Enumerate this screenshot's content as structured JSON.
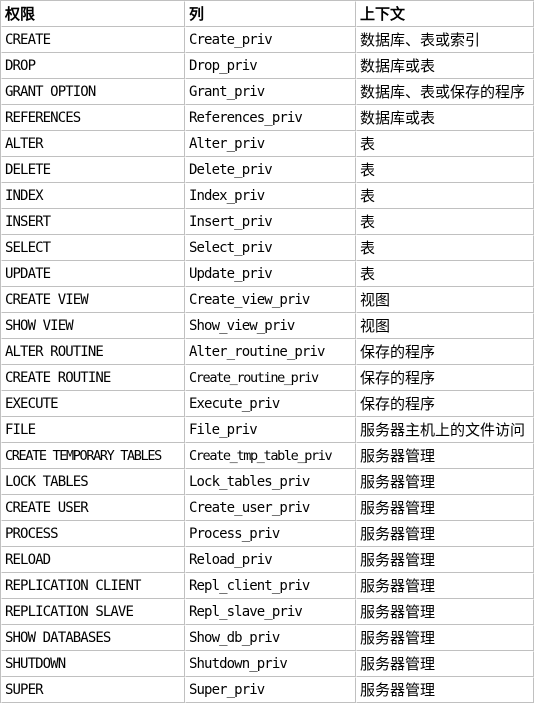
{
  "table": {
    "name": "mysql-privileges-reference-table",
    "columns": [
      {
        "key": "privilege",
        "label": "权限"
      },
      {
        "key": "column",
        "label": "列"
      },
      {
        "key": "context",
        "label": "上下文"
      }
    ],
    "rows": [
      {
        "privilege": "CREATE",
        "column": "Create_priv",
        "context": "数据库、表或索引"
      },
      {
        "privilege": "DROP",
        "column": "Drop_priv",
        "context": "数据库或表"
      },
      {
        "privilege": "GRANT OPTION",
        "column": "Grant_priv",
        "context": "数据库、表或保存的程序"
      },
      {
        "privilege": "REFERENCES",
        "column": "References_priv",
        "context": "数据库或表"
      },
      {
        "privilege": "ALTER",
        "column": "Alter_priv",
        "context": "表"
      },
      {
        "privilege": "DELETE",
        "column": "Delete_priv",
        "context": "表"
      },
      {
        "privilege": "INDEX",
        "column": "Index_priv",
        "context": "表"
      },
      {
        "privilege": "INSERT",
        "column": "Insert_priv",
        "context": "表"
      },
      {
        "privilege": "SELECT",
        "column": "Select_priv",
        "context": "表"
      },
      {
        "privilege": "UPDATE",
        "column": "Update_priv",
        "context": "表"
      },
      {
        "privilege": "CREATE VIEW",
        "column": "Create_view_priv",
        "context": "视图"
      },
      {
        "privilege": "SHOW VIEW",
        "column": "Show_view_priv",
        "context": "视图"
      },
      {
        "privilege": "ALTER ROUTINE",
        "column": "Alter_routine_priv",
        "context": "保存的程序"
      },
      {
        "privilege": "CREATE ROUTINE",
        "column": "Create_routine_priv",
        "context": "保存的程序"
      },
      {
        "privilege": "EXECUTE",
        "column": "Execute_priv",
        "context": "保存的程序"
      },
      {
        "privilege": "FILE",
        "column": "File_priv",
        "context": "服务器主机上的文件访问"
      },
      {
        "privilege": "CREATE TEMPORARY TABLES",
        "column": "Create_tmp_table_priv",
        "context": "服务器管理"
      },
      {
        "privilege": "LOCK TABLES",
        "column": "Lock_tables_priv",
        "context": "服务器管理"
      },
      {
        "privilege": "CREATE USER",
        "column": "Create_user_priv",
        "context": "服务器管理"
      },
      {
        "privilege": "PROCESS",
        "column": "Process_priv",
        "context": "服务器管理"
      },
      {
        "privilege": "RELOAD",
        "column": "Reload_priv",
        "context": "服务器管理"
      },
      {
        "privilege": "REPLICATION CLIENT",
        "column": "Repl_client_priv",
        "context": "服务器管理"
      },
      {
        "privilege": "REPLICATION SLAVE",
        "column": "Repl_slave_priv",
        "context": "服务器管理"
      },
      {
        "privilege": "SHOW DATABASES",
        "column": "Show_db_priv",
        "context": "服务器管理"
      },
      {
        "privilege": "SHUTDOWN",
        "column": "Shutdown_priv",
        "context": "服务器管理"
      },
      {
        "privilege": "SUPER",
        "column": "Super_priv",
        "context": "服务器管理"
      }
    ]
  },
  "colors": {
    "background": "#ffffff",
    "text": "#000000",
    "border": "#c0c0c0",
    "border_highlight": "#ffffff"
  }
}
